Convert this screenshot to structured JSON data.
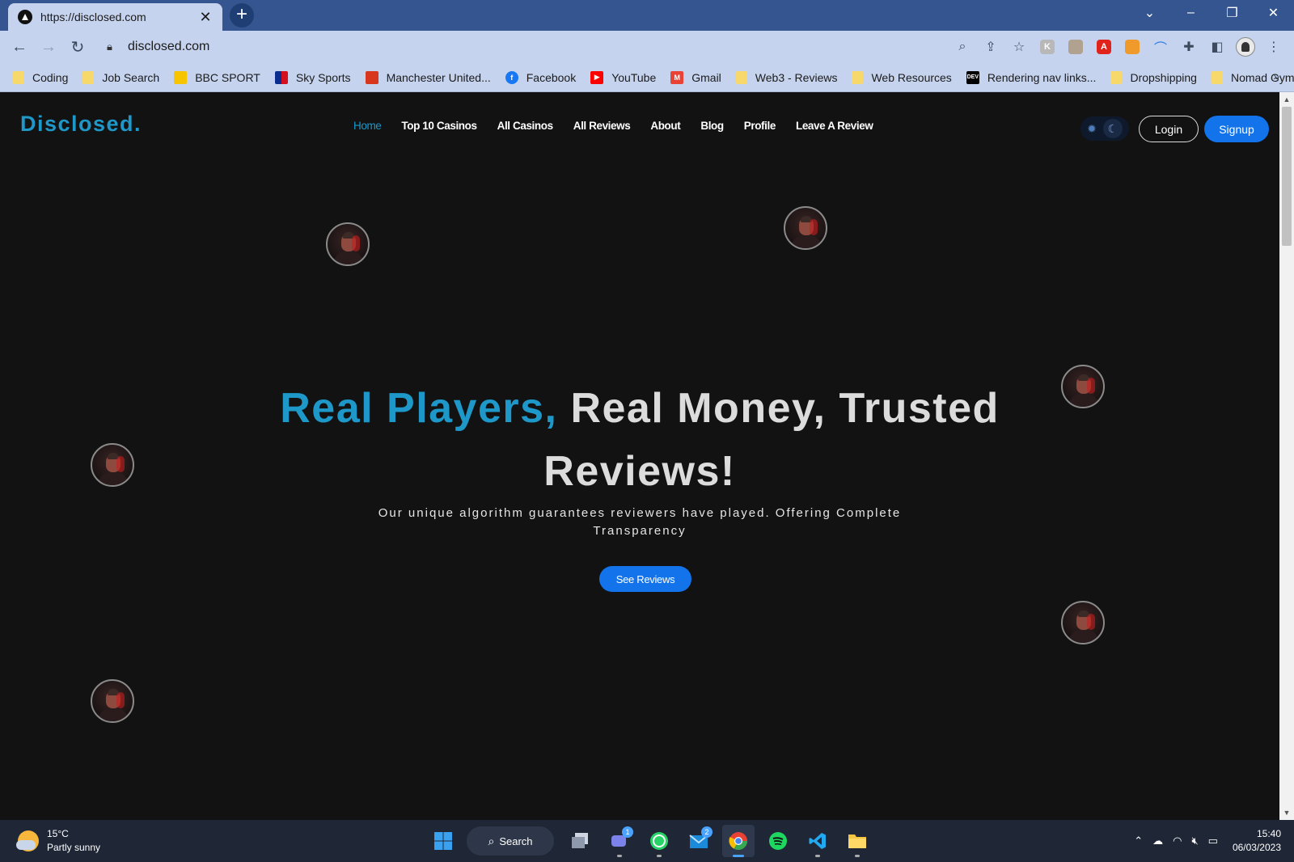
{
  "browser": {
    "tab_title": "https://disclosed.com",
    "tab_close": "✕",
    "new_tab": "+",
    "url": "disclosed.com",
    "bookmarks": [
      {
        "label": "Coding",
        "icon": "folder-icon"
      },
      {
        "label": "Job Search",
        "icon": "folder-icon"
      },
      {
        "label": "BBC SPORT",
        "icon": "bbc-sport-icon"
      },
      {
        "label": "Sky Sports",
        "icon": "sky-sports-icon"
      },
      {
        "label": "Manchester United...",
        "icon": "man-united-icon"
      },
      {
        "label": "Facebook",
        "icon": "facebook-icon"
      },
      {
        "label": "YouTube",
        "icon": "youtube-icon"
      },
      {
        "label": "Gmail",
        "icon": "gmail-icon"
      },
      {
        "label": "Web3 - Reviews",
        "icon": "folder-icon"
      },
      {
        "label": "Web Resources",
        "icon": "folder-icon"
      },
      {
        "label": "Rendering nav links...",
        "icon": "dev-icon"
      },
      {
        "label": "Dropshipping",
        "icon": "folder-icon"
      },
      {
        "label": "Nomad Gym",
        "icon": "folder-icon"
      }
    ],
    "more": "»",
    "dev_label": "DEV",
    "ext_k": "K",
    "ext_a": "A"
  },
  "site": {
    "logo": "Disclosed.",
    "nav": [
      {
        "label": "Home",
        "active": true
      },
      {
        "label": "Top 10 Casinos"
      },
      {
        "label": "All Casinos"
      },
      {
        "label": "All Reviews"
      },
      {
        "label": "About"
      },
      {
        "label": "Blog"
      },
      {
        "label": "Profile"
      },
      {
        "label": "Leave A Review"
      }
    ],
    "login_label": "Login",
    "signup_label": "Signup",
    "hero": {
      "title_accent": "Real Players,",
      "title_rest": " Real Money, Trusted",
      "title_line2": "Reviews!",
      "subtitle": "Our unique algorithm guarantees reviewers have played. Offering Complete Transparency",
      "cta_label": "See Reviews"
    }
  },
  "taskbar": {
    "weather_temp": "15°C",
    "weather_desc": "Partly sunny",
    "search_label": "Search",
    "teams_badge": "1",
    "mail_badge": "2",
    "time": "15:40",
    "date": "06/03/2023"
  },
  "colors": {
    "accent": "#1d98c9",
    "primary_button": "#1273eb",
    "page_bg": "#121212",
    "chrome": "#c5d3ee",
    "tabbar": "#34558f"
  }
}
